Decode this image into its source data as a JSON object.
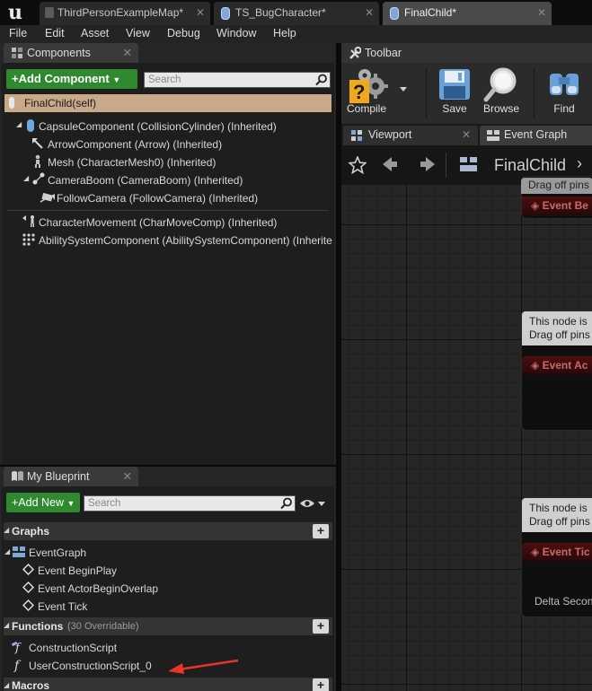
{
  "tabs": [
    {
      "label": "ThirdPersonExampleMap*"
    },
    {
      "label": "TS_BugCharacter*"
    },
    {
      "label": "FinalChild*"
    }
  ],
  "menu": [
    "File",
    "Edit",
    "Asset",
    "View",
    "Debug",
    "Window",
    "Help"
  ],
  "components_panel": {
    "title": "Components",
    "add_button": "+Add Component",
    "search_placeholder": "Search",
    "self_item": "FinalChild(self)",
    "tree": [
      {
        "label": "CapsuleComponent (CollisionCylinder) (Inherited)",
        "icon": "capsule-icon"
      },
      {
        "label": "ArrowComponent (Arrow) (Inherited)",
        "icon": "arrow-icon"
      },
      {
        "label": "Mesh (CharacterMesh0) (Inherited)",
        "icon": "mesh-icon"
      },
      {
        "label": "CameraBoom (CameraBoom) (Inherited)",
        "icon": "spring-arm-icon"
      },
      {
        "label": "FollowCamera (FollowCamera) (Inherited)",
        "icon": "camera-icon"
      },
      {
        "label": "CharacterMovement (CharMoveComp) (Inherited)",
        "icon": "movement-icon"
      },
      {
        "label": "AbilitySystemComponent (AbilitySystemComponent) (Inherite",
        "icon": "component-icon"
      }
    ]
  },
  "toolbar": {
    "title": "Toolbar",
    "buttons": [
      {
        "label": "Compile",
        "icon": "compile-icon"
      },
      {
        "label": "Save",
        "icon": "save-icon"
      },
      {
        "label": "Browse",
        "icon": "browse-icon"
      },
      {
        "label": "Find",
        "icon": "find-icon"
      }
    ]
  },
  "editor_tabs": [
    {
      "label": "Viewport"
    },
    {
      "label": "Event Graph"
    }
  ],
  "graph": {
    "breadcrumb": "FinalChild",
    "nodes": [
      {
        "comment": "Drag off pins",
        "title": "Event Be"
      },
      {
        "comment_line1": "This node is",
        "comment_line2": "Drag off pins",
        "title": "Event Ac"
      },
      {
        "comment_line1": "This node is",
        "comment_line2": "Drag off pins",
        "title": "Event Tic",
        "pin": "Delta Secon"
      }
    ]
  },
  "my_blueprint": {
    "title": "My Blueprint",
    "add_button": "+Add New",
    "search_placeholder": "Search",
    "graphs_label": "Graphs",
    "event_graph": "EventGraph",
    "events": [
      "Event BeginPlay",
      "Event ActorBeginOverlap",
      "Event Tick"
    ],
    "functions_label": "Functions",
    "functions_note": "(30 Overridable)",
    "functions": [
      "ConstructionScript",
      "UserConstructionScript_0"
    ],
    "macros_label": "Macros"
  },
  "colors": {
    "accent_green": "#2f8a2f",
    "self_row": "#c9a98a",
    "annotation_arrow": "#e8342c"
  }
}
